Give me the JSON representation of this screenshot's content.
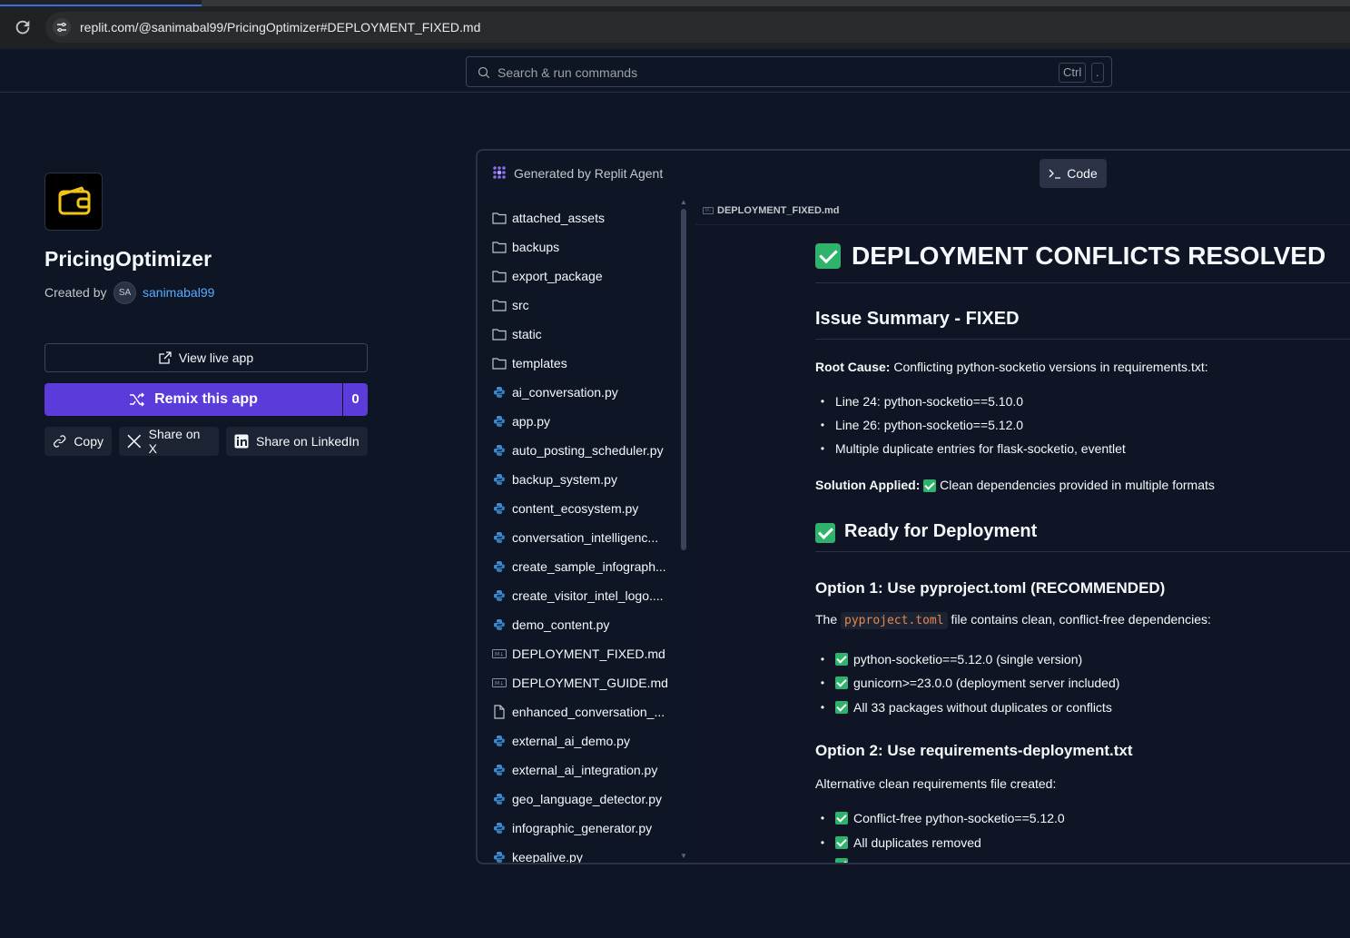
{
  "browser": {
    "url": "replit.com/@sanimabal99/PricingOptimizer#DEPLOYMENT_FIXED.md"
  },
  "header": {
    "search_placeholder": "Search & run commands",
    "kbd_ctrl": "Ctrl",
    "kbd_dot": "."
  },
  "app": {
    "title": "PricingOptimizer",
    "created_by_label": "Created by",
    "avatar_initials": "SA",
    "author": "sanimabal99",
    "view_live_label": "View live app",
    "remix_label": "Remix this app",
    "remix_count": "0",
    "copy_label": "Copy",
    "share_x_label": "Share on X",
    "share_linkedin_label": "Share on LinkedIn"
  },
  "panel": {
    "agent_label": "Generated by Replit Agent",
    "code_label": "Code"
  },
  "files": [
    {
      "name": "attached_assets",
      "kind": "folder"
    },
    {
      "name": "backups",
      "kind": "folder"
    },
    {
      "name": "export_package",
      "kind": "folder"
    },
    {
      "name": "src",
      "kind": "folder"
    },
    {
      "name": "static",
      "kind": "folder"
    },
    {
      "name": "templates",
      "kind": "folder"
    },
    {
      "name": "ai_conversation.py",
      "kind": "python"
    },
    {
      "name": "app.py",
      "kind": "python"
    },
    {
      "name": "auto_posting_scheduler.py",
      "kind": "python"
    },
    {
      "name": "backup_system.py",
      "kind": "python"
    },
    {
      "name": "content_ecosystem.py",
      "kind": "python"
    },
    {
      "name": "conversation_intelligenc...",
      "kind": "python"
    },
    {
      "name": "create_sample_infograph...",
      "kind": "python"
    },
    {
      "name": "create_visitor_intel_logo....",
      "kind": "python"
    },
    {
      "name": "demo_content.py",
      "kind": "python"
    },
    {
      "name": "DEPLOYMENT_FIXED.md",
      "kind": "markdown"
    },
    {
      "name": "DEPLOYMENT_GUIDE.md",
      "kind": "markdown"
    },
    {
      "name": "enhanced_conversation_...",
      "kind": "file"
    },
    {
      "name": "external_ai_demo.py",
      "kind": "python"
    },
    {
      "name": "external_ai_integration.py",
      "kind": "python"
    },
    {
      "name": "geo_language_detector.py",
      "kind": "python"
    },
    {
      "name": "infographic_generator.py",
      "kind": "python"
    },
    {
      "name": "keepalive.py",
      "kind": "python"
    }
  ],
  "doc": {
    "tab_label": "DEPLOYMENT_FIXED.md",
    "h1": "DEPLOYMENT CONFLICTS RESOLVED",
    "h2_issue": "Issue Summary - FIXED",
    "root_cause_label": "Root Cause:",
    "root_cause_text": "Conflicting python-socketio versions in requirements.txt:",
    "issue_items": [
      "Line 24: python-socketio==5.10.0",
      "Line 26: python-socketio==5.12.0",
      "Multiple duplicate entries for flask-socketio, eventlet"
    ],
    "solution_label": "Solution Applied:",
    "solution_text": "Clean dependencies provided in multiple formats",
    "h2_ready": "Ready for Deployment",
    "h3_option1": "Option 1: Use pyproject.toml (RECOMMENDED)",
    "option1_pre": "The",
    "option1_code": "pyproject.toml",
    "option1_post": "file contains clean, conflict-free dependencies:",
    "option1_items": [
      "python-socketio==5.12.0 (single version)",
      "gunicorn>=23.0.0 (deployment server included)",
      "All 33 packages without duplicates or conflicts"
    ],
    "h3_option2": "Option 2: Use requirements-deployment.txt",
    "option2_text": "Alternative clean requirements file created:",
    "option2_items": [
      "Conflict-free python-socketio==5.12.0",
      "All duplicates removed"
    ]
  },
  "colors": {
    "background": "#0e1525",
    "accent": "#5b3cdb",
    "link": "#57abff",
    "check_green": "#2fb36c"
  }
}
